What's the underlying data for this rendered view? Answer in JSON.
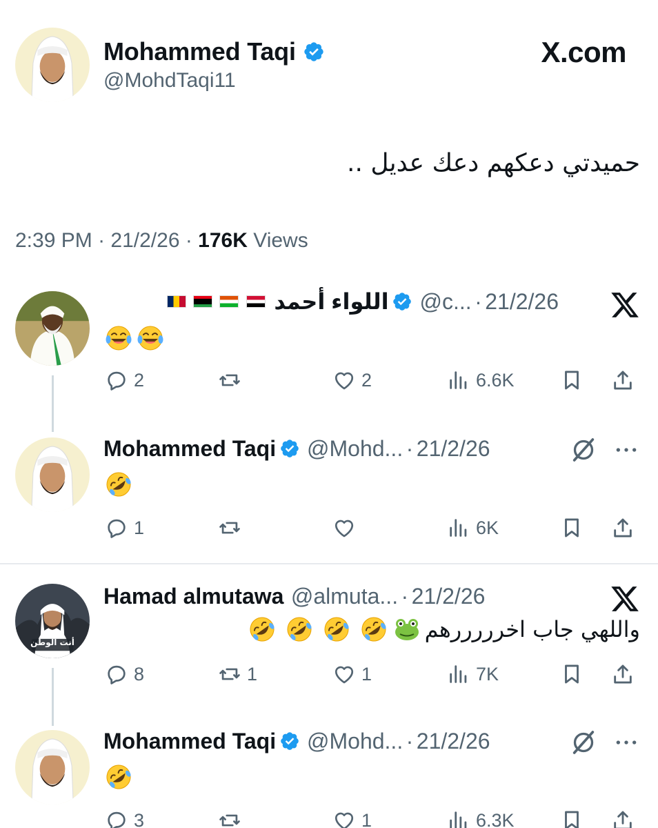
{
  "main_tweet": {
    "author_name": "Mohammed Taqi",
    "author_handle": "@MohdTaqi11",
    "site_label": "X.com",
    "text": "حميدتي دعكهم دعك عديل ..",
    "time": "2:39 PM",
    "date": "21/2/26",
    "views_count": "176K",
    "views_label": "Views"
  },
  "replies": [
    {
      "name": "اللواء أحمد",
      "handle": "@c...",
      "date": "21/2/26",
      "text": "😂😂",
      "flags": [
        "Chad",
        "Libya",
        "Niger",
        "Sudan"
      ],
      "replies": "2",
      "reposts": "",
      "likes": "2",
      "views": "6.6K",
      "corner_icon": "x-logo-icon"
    },
    {
      "name": "Mohammed Taqi",
      "handle": "@Mohd...",
      "date": "21/2/26",
      "text": "🤣",
      "replies": "1",
      "reposts": "",
      "likes": "",
      "views": "6K",
      "corner_icon": "grok-icon"
    },
    {
      "name": "Hamad almutawa",
      "handle": "@almuta...",
      "date": "21/2/26",
      "text": "واللهي جاب اخرررررهم",
      "avatar_caption": "أنت الوطن",
      "replies": "8",
      "reposts": "1",
      "likes": "1",
      "views": "7K",
      "corner_icon": "x-logo-icon"
    },
    {
      "name": "Mohammed Taqi",
      "handle": "@Mohd...",
      "date": "21/2/26",
      "text": "🤣",
      "replies": "3",
      "reposts": "",
      "likes": "1",
      "views": "6.3K",
      "corner_icon": "grok-icon"
    }
  ],
  "colors": {
    "text": "#0f1419",
    "secondary": "#536471",
    "verified": "#1d9bf0"
  }
}
